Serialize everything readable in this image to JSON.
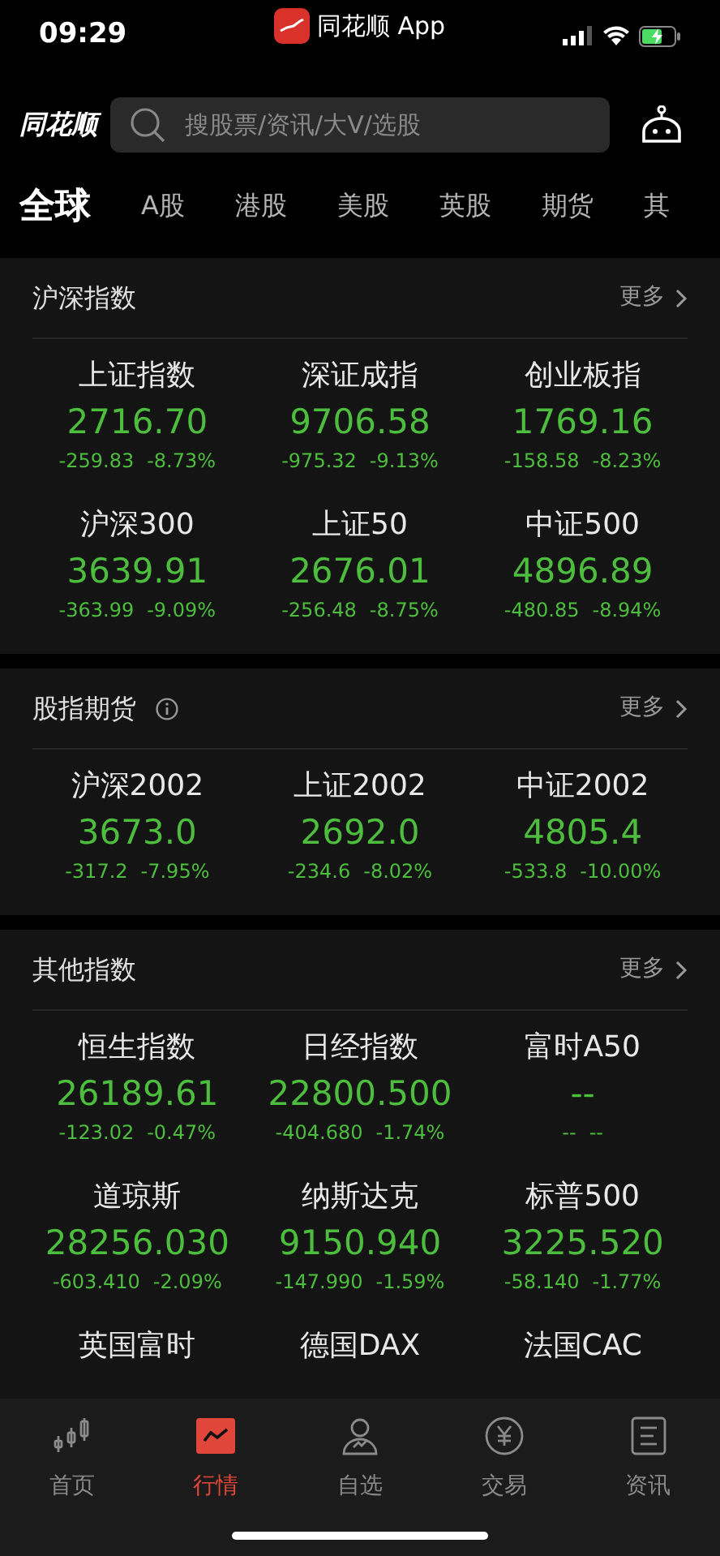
{
  "status_bar": {
    "time": "09:29",
    "app_name": "同花顺 App"
  },
  "header": {
    "logo": "同花顺",
    "search": {
      "placeholder": "搜股票/资讯/大V/选股"
    }
  },
  "tabs": [
    {
      "label": "全球",
      "selected": true
    },
    {
      "label": "A股",
      "selected": false
    },
    {
      "label": "港股",
      "selected": false
    },
    {
      "label": "美股",
      "selected": false
    },
    {
      "label": "英股",
      "selected": false
    },
    {
      "label": "期货",
      "selected": false
    },
    {
      "label": "其",
      "selected": false
    }
  ],
  "sections": [
    {
      "title": "沪深指数",
      "more": "更多",
      "items": [
        {
          "name": "上证指数",
          "price": "2716.70",
          "change": "-259.83",
          "percent": "-8.73%"
        },
        {
          "name": "深证成指",
          "price": "9706.58",
          "change": "-975.32",
          "percent": "-9.13%"
        },
        {
          "name": "创业板指",
          "price": "1769.16",
          "change": "-158.58",
          "percent": "-8.23%"
        },
        {
          "name": "沪深300",
          "price": "3639.91",
          "change": "-363.99",
          "percent": "-9.09%"
        },
        {
          "name": "上证50",
          "price": "2676.01",
          "change": "-256.48",
          "percent": "-8.75%"
        },
        {
          "name": "中证500",
          "price": "4896.89",
          "change": "-480.85",
          "percent": "-8.94%"
        }
      ]
    },
    {
      "title": "股指期货",
      "info": true,
      "more": "更多",
      "items": [
        {
          "name": "沪深2002",
          "price": "3673.0",
          "change": "-317.2",
          "percent": "-7.95%"
        },
        {
          "name": "上证2002",
          "price": "2692.0",
          "change": "-234.6",
          "percent": "-8.02%"
        },
        {
          "name": "中证2002",
          "price": "4805.4",
          "change": "-533.8",
          "percent": "-10.00%"
        }
      ]
    },
    {
      "title": "其他指数",
      "more": "更多",
      "items": [
        {
          "name": "恒生指数",
          "price": "26189.61",
          "change": "-123.02",
          "percent": "-0.47%"
        },
        {
          "name": "日经指数",
          "price": "22800.500",
          "change": "-404.680",
          "percent": "-1.74%"
        },
        {
          "name": "富时A50",
          "price": "--",
          "change": "--",
          "percent": "--"
        },
        {
          "name": "道琼斯",
          "price": "28256.030",
          "change": "-603.410",
          "percent": "-2.09%"
        },
        {
          "name": "纳斯达克",
          "price": "9150.940",
          "change": "-147.990",
          "percent": "-1.59%"
        },
        {
          "name": "标普500",
          "price": "3225.520",
          "change": "-58.140",
          "percent": "-1.77%"
        },
        {
          "name": "英国富时"
        },
        {
          "name": "德国DAX"
        },
        {
          "name": "法国CAC"
        }
      ]
    }
  ],
  "tab_bar": [
    {
      "label": "首页",
      "kind": "candles",
      "selected": false
    },
    {
      "label": "行情",
      "kind": "chart",
      "selected": true
    },
    {
      "label": "自选",
      "kind": "person",
      "selected": false
    },
    {
      "label": "交易",
      "kind": "yen",
      "selected": false
    },
    {
      "label": "资讯",
      "kind": "doc",
      "selected": false
    }
  ]
}
